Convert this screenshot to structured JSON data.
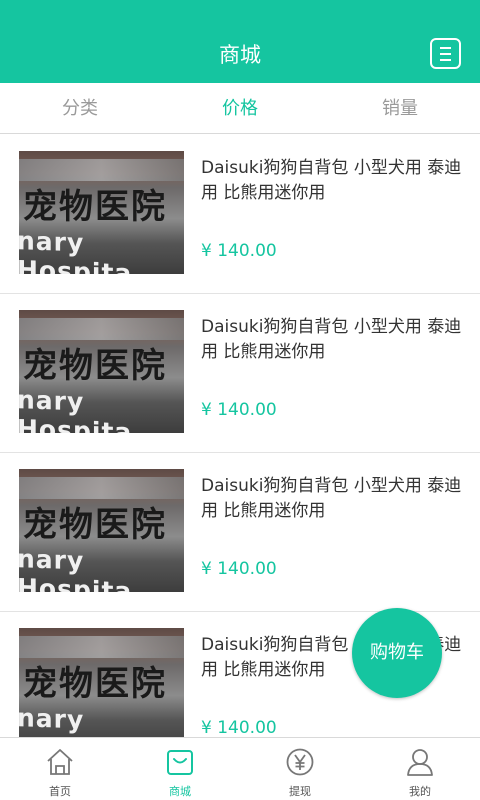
{
  "header": {
    "title": "商城"
  },
  "tabs": [
    {
      "label": "分类",
      "active": false
    },
    {
      "label": "价格",
      "active": true
    },
    {
      "label": "销量",
      "active": false
    }
  ],
  "products": [
    {
      "name": "Daisuki狗狗自背包 小型犬用 泰迪用 比熊用迷你用",
      "price": "¥ 140.00",
      "thumb_text_top": "宠物医院",
      "thumb_text_bottom": "nary Hospita"
    },
    {
      "name": "Daisuki狗狗自背包 小型犬用 泰迪用 比熊用迷你用",
      "price": "¥ 140.00",
      "thumb_text_top": "宠物医院",
      "thumb_text_bottom": "nary Hospita"
    },
    {
      "name": "Daisuki狗狗自背包 小型犬用 泰迪用 比熊用迷你用",
      "price": "¥ 140.00",
      "thumb_text_top": "宠物医院",
      "thumb_text_bottom": "nary Hospita"
    },
    {
      "name": "Daisuki狗狗自背包 小型犬用 泰迪用 比熊用迷你用",
      "price": "¥ 140.00",
      "thumb_text_top": "宠物医院",
      "thumb_text_bottom": "nary Hospita"
    }
  ],
  "cart_button": {
    "label": "购物车"
  },
  "bottom_nav": [
    {
      "label": "首页",
      "icon": "home-icon",
      "active": false
    },
    {
      "label": "商城",
      "icon": "shop-bag-icon",
      "active": true
    },
    {
      "label": "提现",
      "icon": "yen-coin-icon",
      "active": false
    },
    {
      "label": "我的",
      "icon": "user-icon",
      "active": false
    }
  ],
  "colors": {
    "accent": "#15c5a0",
    "inactive": "#9a9a9a"
  }
}
